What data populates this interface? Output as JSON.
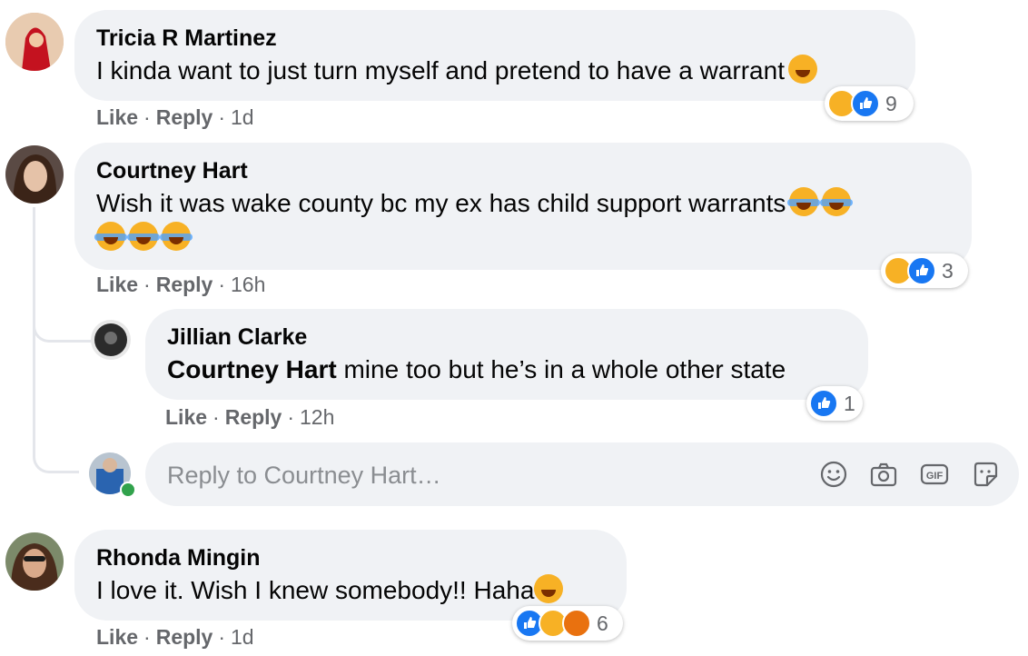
{
  "comments": [
    {
      "author": "Tricia R Martinez",
      "text": "I kinda want to just turn myself and pretend to have a warrant",
      "like_label": "Like",
      "reply_label": "Reply",
      "time": "1d",
      "reaction_count": "9"
    },
    {
      "author": "Courtney Hart",
      "text": "Wish it was wake county bc my ex has child support warrants",
      "like_label": "Like",
      "reply_label": "Reply",
      "time": "16h",
      "reaction_count": "3"
    },
    {
      "author": "Rhonda Mingin",
      "text": "I love it. Wish I knew somebody!! Haha",
      "like_label": "Like",
      "reply_label": "Reply",
      "time": "1d",
      "reaction_count": "6"
    }
  ],
  "reply": {
    "author": "Jillian Clarke",
    "mention": "Courtney Hart",
    "text": "mine too but he’s in a whole other state",
    "like_label": "Like",
    "reply_label": "Reply",
    "time": "12h",
    "reaction_count": "1"
  },
  "reply_box": {
    "placeholder": "Reply to Courtney Hart…"
  },
  "colors": {
    "bubble": "#f0f2f5",
    "like_blue": "#1877f2",
    "haha_yellow": "#f7b125",
    "meta_gray": "#65676b"
  },
  "icons": [
    "emoji-icon",
    "camera-icon",
    "gif-icon",
    "sticker-icon"
  ]
}
